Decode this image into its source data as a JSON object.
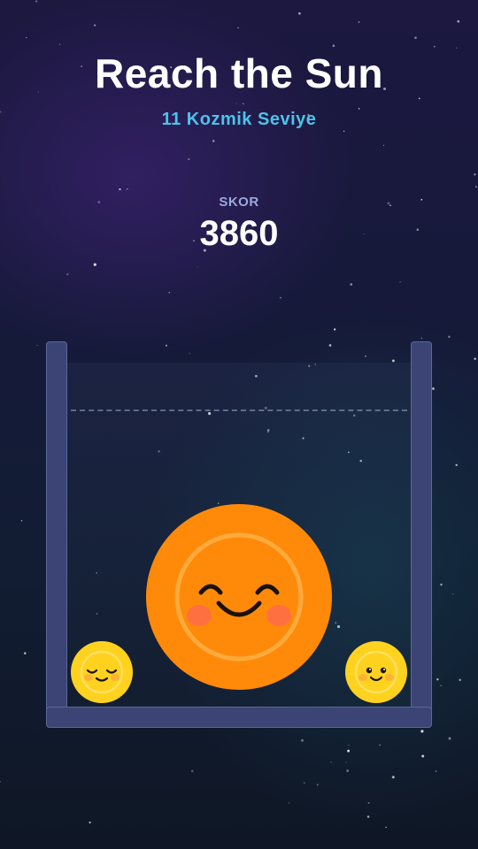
{
  "game": {
    "title": "Reach the Sun",
    "subtitle": "11 Kozmik Seviye"
  },
  "score": {
    "label": "SKOR",
    "value": "3860"
  },
  "colors": {
    "title": "#ffffff",
    "subtitle": "#4cc3ea",
    "score_label": "#9da8dc",
    "container": "#3b4474",
    "sun_orange": "#ff8a0a",
    "small_sun_yellow": "#ffd21f"
  },
  "balls": [
    {
      "name": "orange-sun-ball",
      "kind": "large-orange",
      "expression": "happy-closed-eyes"
    },
    {
      "name": "yellow-sun-ball-left",
      "kind": "small-yellow",
      "expression": "sleepy-closed-eyes"
    },
    {
      "name": "yellow-sun-ball-right",
      "kind": "small-yellow",
      "expression": "open-eyes-smile"
    }
  ]
}
